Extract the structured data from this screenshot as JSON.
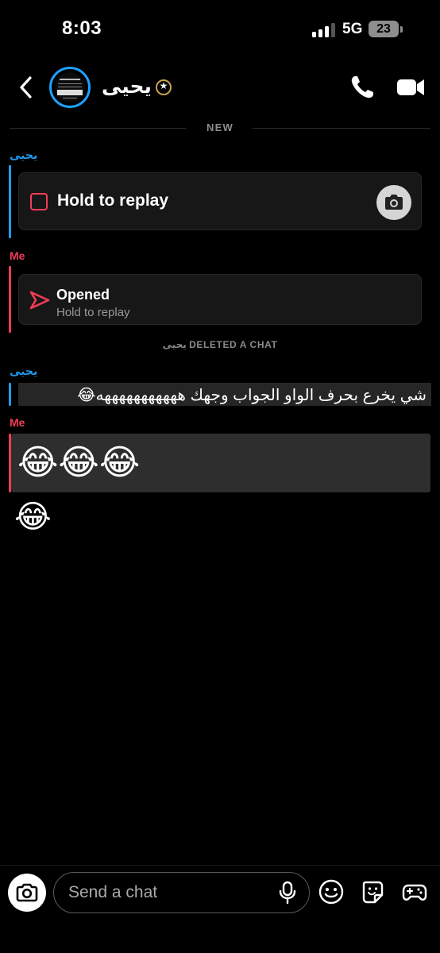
{
  "status_bar": {
    "time": "8:03",
    "network": "5G",
    "battery": "23"
  },
  "header": {
    "contact_name": "يحيى",
    "back_icon": "chevron-left-icon",
    "call_icon": "phone-icon",
    "video_icon": "video-camera-icon"
  },
  "conversation": {
    "new_label": "NEW",
    "messages": [
      {
        "sender": "يحيى",
        "type": "snap",
        "label": "Hold to replay"
      },
      {
        "sender": "Me",
        "type": "snap-sent",
        "label": "Opened",
        "sublabel": "Hold to replay"
      },
      {
        "sender": "Me",
        "type": "emoji",
        "text": "😂😂😂"
      },
      {
        "sender": "",
        "type": "emoji",
        "text": "😂"
      }
    ],
    "deleted_notice": "يحيى DELETED A CHAT",
    "reply": {
      "sender": "يحيى",
      "text": "شي يخرع بحرف الواو الجواب وجهك هههههههههههه😂"
    }
  },
  "composer": {
    "placeholder": "Send a chat",
    "camera_icon": "camera-icon",
    "mic_icon": "microphone-icon",
    "emoji_icon": "smiley-icon",
    "sticker_icon": "sticker-icon",
    "games_icon": "gamepad-icon"
  },
  "colors": {
    "friend_accent": "#1e9bf0",
    "me_accent": "#f23c57",
    "background": "#000000"
  }
}
